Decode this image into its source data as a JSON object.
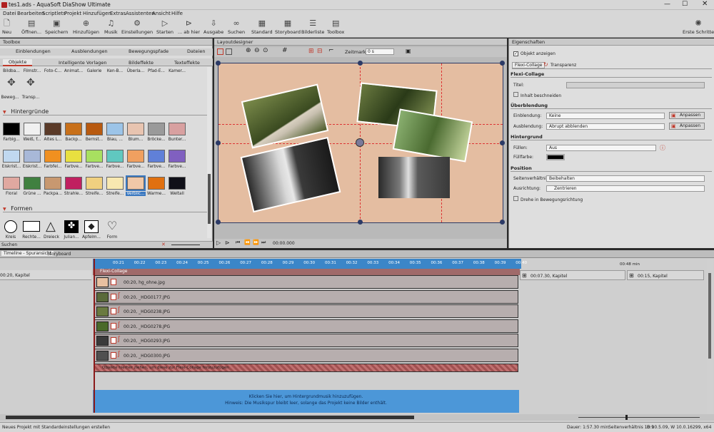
{
  "window": {
    "title": "tes1.ads - AquaSoft DiaShow Ultimate"
  },
  "menu": [
    "Datei",
    "Bearbeiten",
    "Scriptlets",
    "Projekt",
    "Hinzufügen",
    "Extras",
    "Assistenten",
    "Ansicht",
    "Hilfe"
  ],
  "toolbar": [
    {
      "label": "Neu",
      "icon": "new-icon"
    },
    {
      "label": "Öffnen...",
      "icon": "open-icon"
    },
    {
      "label": "Speichern",
      "icon": "save-icon"
    },
    {
      "label": "Hinzufügen",
      "icon": "add-icon"
    },
    {
      "label": "Musik",
      "icon": "music-icon"
    },
    {
      "label": "Einstellungen",
      "icon": "settings-icon"
    },
    {
      "label": "Starten",
      "icon": "play-icon"
    },
    {
      "label": "... ab hier",
      "icon": "play-from-here-icon"
    },
    {
      "label": "Ausgabe",
      "icon": "output-icon"
    },
    {
      "label": "Suchen",
      "icon": "search-icon"
    },
    {
      "label": "Standard",
      "icon": "standard-icon"
    },
    {
      "label": "Storyboard",
      "icon": "storyboard-icon"
    },
    {
      "label": "Bilderliste",
      "icon": "list-icon"
    },
    {
      "label": "Toolbox",
      "icon": "toolbox-icon"
    },
    {
      "label": "Erste Schritte",
      "icon": "bulb-icon"
    }
  ],
  "toolbox": {
    "title": "Toolbox",
    "tabs1": [
      "Einblendungen",
      "Ausblendungen",
      "Bewegungspfade",
      "Dateien"
    ],
    "tabs2": [
      "Objekte",
      "Intelligente Vorlagen",
      "Bildeffekte",
      "Texteffekte"
    ],
    "objects": [
      "Bildba...",
      "Filmstr...",
      "Foto-C...",
      "Animat...",
      "Galerie",
      "Ken-B...",
      "Überla...",
      "Pfad-E...",
      "Kamer..."
    ],
    "motion": [
      "Beweg...",
      "Transp..."
    ],
    "section_backgrounds": "Hintergründe",
    "backgrounds": [
      {
        "label": "Farbig...",
        "color": "#000000"
      },
      {
        "label": "Weiß, f...",
        "color": "#f0f0f0"
      },
      {
        "label": "Altes L...",
        "color": "#5a3a28"
      },
      {
        "label": "Backp...",
        "color": "#c8701a"
      },
      {
        "label": "Bernst...",
        "color": "#b85a10"
      },
      {
        "label": "Blau, ...",
        "color": "#9cc4e8"
      },
      {
        "label": "Blum...",
        "color": "#e8c4b0"
      },
      {
        "label": "Bröcke...",
        "color": "#9a9a9a"
      },
      {
        "label": "Bunter...",
        "color": "#d8a0a0"
      },
      {
        "label": "Eiskrist...",
        "color": "#c0d8f0"
      },
      {
        "label": "Eiskrist...",
        "color": "#a8b8d8"
      },
      {
        "label": "Farbfel...",
        "color": "#f09020"
      },
      {
        "label": "Farbve...",
        "color": "#e8e040"
      },
      {
        "label": "Farbve...",
        "color": "#a8e060"
      },
      {
        "label": "Farbve...",
        "color": "#60c8c0"
      },
      {
        "label": "Farbve...",
        "color": "#f0a060"
      },
      {
        "label": "Farbve...",
        "color": "#6080d8"
      },
      {
        "label": "Farbve...",
        "color": "#8060c0"
      },
      {
        "label": "Floral",
        "color": "#e0a8a0"
      },
      {
        "label": "Grüne ...",
        "color": "#408040"
      },
      {
        "label": "Packpa...",
        "color": "#c89870"
      },
      {
        "label": "Strahle...",
        "color": "#c02060"
      },
      {
        "label": "Streife...",
        "color": "#f0d080"
      },
      {
        "label": "Streife...",
        "color": "#f8e8b0"
      },
      {
        "label": "Verblic...",
        "color": "#f0c8a8"
      },
      {
        "label": "Warme...",
        "color": "#e07010"
      },
      {
        "label": "Weltall",
        "color": "#101018"
      }
    ],
    "section_shapes": "Formen",
    "shapes": [
      "Kreis",
      "Rechte...",
      "Dreieck",
      "Julian...",
      "Apfelm...",
      "Form"
    ],
    "search_label": "Suchen"
  },
  "layout": {
    "title": "Layoutdesigner",
    "zeitmarke_label": "Zeitmarke:",
    "zeitmarke_value": "0 s",
    "time": "00:00.000"
  },
  "props": {
    "title": "Eigenschaften",
    "show_object": "Objekt anzeigen",
    "tabs": [
      "Flexi-Collage",
      "Transparenz"
    ],
    "section_flexi": "Flexi-Collage",
    "titel_label": "Titel:",
    "crop_label": "Inhalt beschneiden",
    "section_blend": "Überblendung",
    "einblendung_label": "Einblendung:",
    "einblendung_value": "Keine",
    "ausblendung_label": "Ausblendung:",
    "ausblendung_value": "Abrupt abblenden",
    "anpassen": "Anpassen",
    "section_bg": "Hintergrund",
    "fuellen_label": "Füllen:",
    "fuellen_value": "Aus",
    "fuellfarbe_label": "Füllfarbe:",
    "section_pos": "Position",
    "ratio_label": "Seitenverhältnis:",
    "ratio_value": "Beibehalten",
    "align_label": "Ausrichtung:",
    "align_value": "Zentrieren",
    "rotate_label": "Drehe in Bewegungsrichtung"
  },
  "timeline": {
    "tabs": [
      "Timeline - Spuransicht",
      "Storyboard"
    ],
    "ticks": [
      "00:21",
      "00:22",
      "00:23",
      "00:24",
      "00:25",
      "00:26",
      "00:27",
      "00:28",
      "00:29",
      "00:30",
      "00:31",
      "00:32",
      "00:33",
      "00:34",
      "00:35",
      "00:36",
      "00:37",
      "00:38",
      "00:39",
      "00:40"
    ],
    "right_tick": "00:48 min",
    "chapter_left": "00:20, Kapitel",
    "chapter_mid": "00:07.30, Kapitel",
    "chapter_right": "00:15, Kapitel",
    "group_label": "Flexi-Collage",
    "tracks": [
      {
        "label": "00:20, hg_ohne.jpg",
        "color": "#e8c0a0"
      },
      {
        "label": "00:20, _HDG0177.JPG",
        "color": "#5a6a3a"
      },
      {
        "label": "00:20, _HDG0238.JPG",
        "color": "#6a7a40"
      },
      {
        "label": "00:20, _HDG0278.JPG",
        "color": "#4a6a2a"
      },
      {
        "label": "00:20, _HDG0293.JPG",
        "color": "#3a3a3a"
      },
      {
        "label": "00:20, _HDG0300.JPG",
        "color": "#505050"
      }
    ],
    "drop_hint": "Objekte hierher ziehen, um diese zur Flexi-Collage hinzuzufügen",
    "music_line1": "Klicken Sie hier, um Hintergrundmusik hinzuzufügen.",
    "music_line2": "Hinweis: Die Musikspur bleibt leer, solange das Projekt keine Bilder enthält."
  },
  "status": {
    "left": "Neues Projekt mit Standardeinstellungen erstellen",
    "dauer": "Dauer: 1:57.30 min",
    "ratio": "Seitenverhältnis 16:9",
    "version": "D 10.5.09, W 10.0.16299, x64"
  }
}
